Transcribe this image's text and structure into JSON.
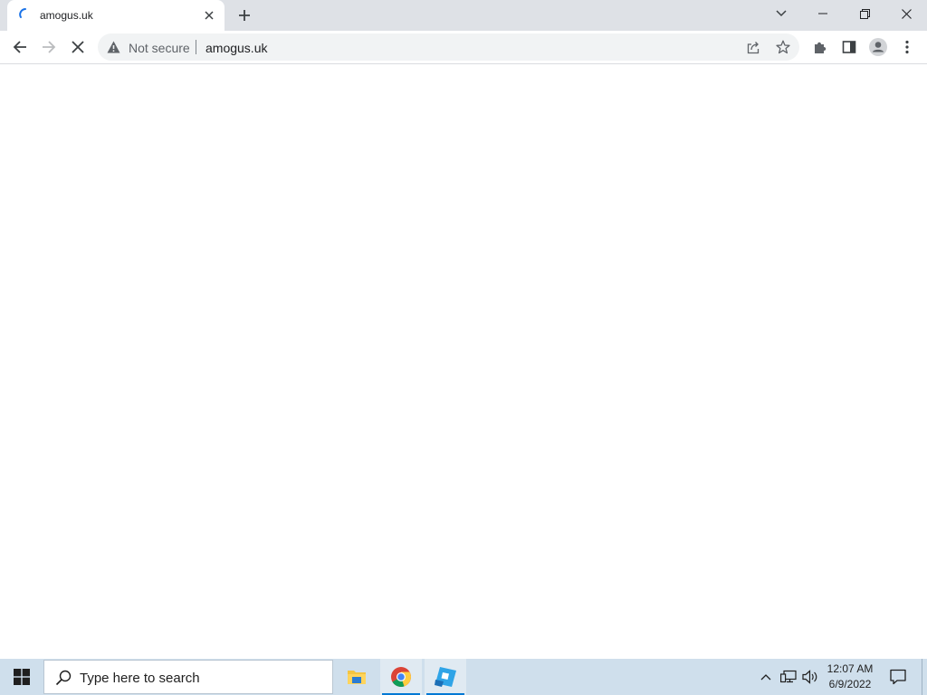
{
  "browser": {
    "tab": {
      "title": "amogus.uk",
      "loading": true
    },
    "toolbar": {
      "security_label": "Not secure",
      "url": "amogus.uk"
    }
  },
  "taskbar": {
    "search_placeholder": "Type here to search",
    "apps": [
      "file-explorer",
      "chrome",
      "roblox-studio"
    ],
    "clock": {
      "time": "12:07 AM",
      "date": "6/9/2022"
    }
  },
  "colors": {
    "tab_strip": "#dee1e6",
    "omnibox": "#f1f3f4",
    "taskbar": "#cfdfec",
    "accent": "#0078d4"
  }
}
